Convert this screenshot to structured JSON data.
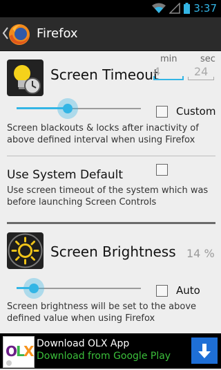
{
  "status": {
    "time": "3:37"
  },
  "appbar": {
    "title": "Firefox"
  },
  "timeout": {
    "title": "Screen Timeout",
    "min_label": "min",
    "sec_label": "sec",
    "min_value": "4",
    "sec_value": "24",
    "custom_label": "Custom",
    "slider_value_fraction": 0.41,
    "description": "Screen blackouts & locks after inactivity of above defined interval when using Firefox"
  },
  "system_default": {
    "title": "Use System Default",
    "description": "Use screen timeout of the system which was before launching Screen Controls"
  },
  "brightness": {
    "title": "Screen Brightness",
    "percent": "14 %",
    "auto_label": "Auto",
    "slider_value_fraction": 0.14,
    "description": "Screen brightness will be set to the above defined value when using Firefox"
  },
  "ad": {
    "brand": "OLX",
    "title": "Download OLX App",
    "subtitle": "Download from Google Play"
  },
  "colors": {
    "accent": "#33b5e5",
    "ad_green": "#3bbf3b",
    "download_blue": "#1e6fd6"
  }
}
